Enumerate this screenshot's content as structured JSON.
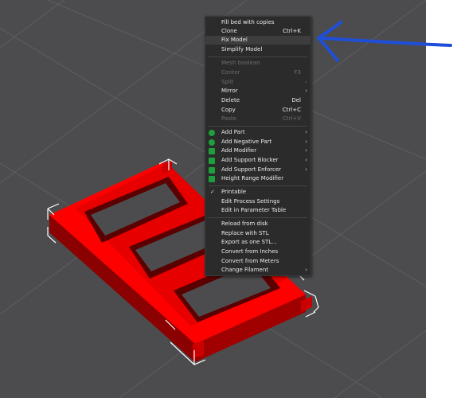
{
  "menu": {
    "items": [
      {
        "label": "Fill bed with copies",
        "shortcut": "",
        "submenu": false,
        "disabled": false
      },
      {
        "label": "Clone",
        "shortcut": "Ctrl+K",
        "submenu": false,
        "disabled": false
      },
      {
        "label": "Fix Model",
        "shortcut": "",
        "submenu": false,
        "disabled": false,
        "highlighted": true
      },
      {
        "label": "Simplify Model",
        "shortcut": "",
        "submenu": false,
        "disabled": false
      },
      {
        "label": "Mesh boolean",
        "shortcut": "",
        "submenu": false,
        "disabled": true
      },
      {
        "label": "Center",
        "shortcut": "F3",
        "submenu": false,
        "disabled": true
      },
      {
        "label": "Split",
        "shortcut": "",
        "submenu": true,
        "disabled": true
      },
      {
        "label": "Mirror",
        "shortcut": "",
        "submenu": true,
        "disabled": false
      },
      {
        "label": "Delete",
        "shortcut": "Del",
        "submenu": false,
        "disabled": false
      },
      {
        "label": "Copy",
        "shortcut": "Ctrl+C",
        "submenu": false,
        "disabled": false
      },
      {
        "label": "Paste",
        "shortcut": "Ctrl+V",
        "submenu": false,
        "disabled": true
      },
      {
        "label": "Add Part",
        "shortcut": "",
        "submenu": true,
        "disabled": false,
        "icon": "add-part-icon"
      },
      {
        "label": "Add Negative Part",
        "shortcut": "",
        "submenu": true,
        "disabled": false,
        "icon": "add-negative-part-icon"
      },
      {
        "label": "Add Modifier",
        "shortcut": "",
        "submenu": true,
        "disabled": false,
        "icon": "add-modifier-icon"
      },
      {
        "label": "Add Support Blocker",
        "shortcut": "",
        "submenu": true,
        "disabled": false,
        "icon": "support-blocker-icon"
      },
      {
        "label": "Add Support Enforcer",
        "shortcut": "",
        "submenu": true,
        "disabled": false,
        "icon": "support-enforcer-icon"
      },
      {
        "label": "Height Range Modifier",
        "shortcut": "",
        "submenu": false,
        "disabled": false,
        "icon": "height-range-icon"
      },
      {
        "label": "Printable",
        "shortcut": "",
        "submenu": false,
        "disabled": false,
        "checked": true
      },
      {
        "label": "Edit Process Settings",
        "shortcut": "",
        "submenu": false,
        "disabled": false
      },
      {
        "label": "Edit in Parameter Table",
        "shortcut": "",
        "submenu": false,
        "disabled": false
      },
      {
        "label": "Reload from disk",
        "shortcut": "",
        "submenu": false,
        "disabled": false
      },
      {
        "label": "Replace with STL",
        "shortcut": "",
        "submenu": false,
        "disabled": false
      },
      {
        "label": "Export as one STL...",
        "shortcut": "",
        "submenu": false,
        "disabled": false
      },
      {
        "label": "Convert from Inches",
        "shortcut": "",
        "submenu": false,
        "disabled": false
      },
      {
        "label": "Convert from Meters",
        "shortcut": "",
        "submenu": false,
        "disabled": false
      },
      {
        "label": "Change Filament",
        "shortcut": "",
        "submenu": true,
        "disabled": false
      }
    ]
  },
  "colors": {
    "viewport_bg": "#4c4c4e",
    "model_red": "#ff0000",
    "model_dark": "#8b0000",
    "annotation_blue": "#1f4fd8",
    "icon_green": "#1e9e3c"
  }
}
